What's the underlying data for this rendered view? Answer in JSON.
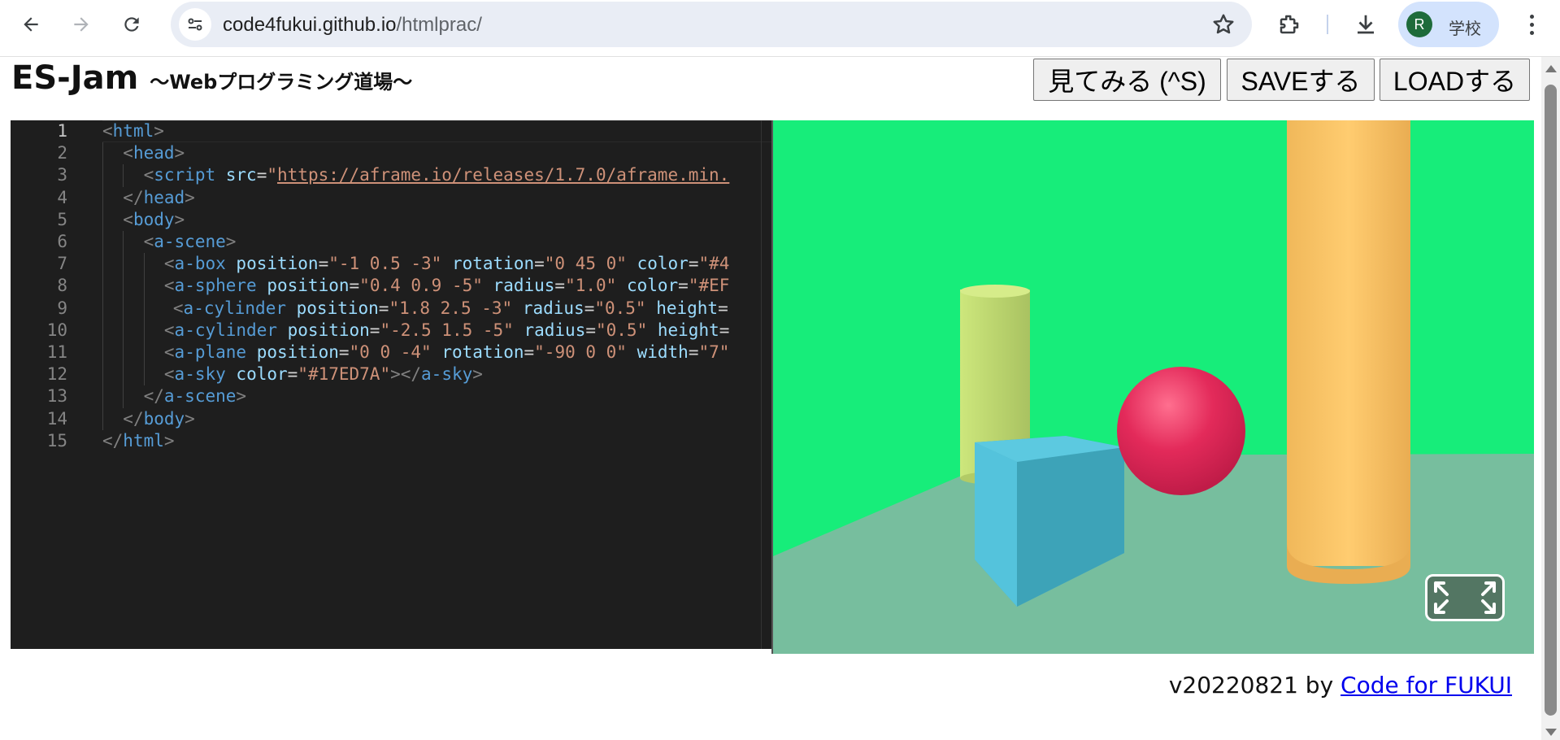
{
  "browser": {
    "url_host": "code4fukui.github.io",
    "url_path": "/htmlprac/",
    "profile_initial": "R",
    "profile_name": "学校",
    "icons": [
      "back-icon",
      "forward-icon",
      "reload-icon",
      "site-info-icon",
      "bookmark-star-icon",
      "extensions-icon",
      "download-icon",
      "kebab-menu-icon"
    ]
  },
  "header": {
    "title": "ES-Jam",
    "subtitle": "〜Webプログラミング道場〜",
    "buttons": {
      "view": "見てみる (^S)",
      "save": "SAVEする",
      "load": "LOADする"
    }
  },
  "editor": {
    "line_numbers": [
      "1",
      "2",
      "3",
      "4",
      "5",
      "6",
      "7",
      "8",
      "9",
      "10",
      "11",
      "12",
      "13",
      "14",
      "15"
    ],
    "active_line": 1,
    "lines": [
      [
        [
          "br",
          "<"
        ],
        [
          "tag",
          "html"
        ],
        [
          "br",
          ">"
        ]
      ],
      [
        [
          "br",
          "<"
        ],
        [
          "tag",
          "head"
        ],
        [
          "br",
          ">"
        ]
      ],
      [
        [
          "br",
          "<"
        ],
        [
          "tag",
          "script"
        ],
        [
          "txt",
          " "
        ],
        [
          "attr",
          "src"
        ],
        [
          "txt",
          "="
        ],
        [
          "str",
          "\""
        ],
        [
          "link",
          "https://aframe.io/releases/1.7.0/aframe.min."
        ]
      ],
      [
        [
          "br",
          "</"
        ],
        [
          "tag",
          "head"
        ],
        [
          "br",
          ">"
        ]
      ],
      [
        [
          "br",
          "<"
        ],
        [
          "tag",
          "body"
        ],
        [
          "br",
          ">"
        ]
      ],
      [
        [
          "br",
          "<"
        ],
        [
          "tag",
          "a-scene"
        ],
        [
          "br",
          ">"
        ]
      ],
      [
        [
          "br",
          "<"
        ],
        [
          "tag",
          "a-box"
        ],
        [
          "txt",
          " "
        ],
        [
          "attr",
          "position"
        ],
        [
          "txt",
          "="
        ],
        [
          "str",
          "\"-1 0.5 -3\""
        ],
        [
          "txt",
          " "
        ],
        [
          "attr",
          "rotation"
        ],
        [
          "txt",
          "="
        ],
        [
          "str",
          "\"0 45 0\""
        ],
        [
          "txt",
          " "
        ],
        [
          "attr",
          "color"
        ],
        [
          "txt",
          "="
        ],
        [
          "str",
          "\"#4"
        ]
      ],
      [
        [
          "br",
          "<"
        ],
        [
          "tag",
          "a-sphere"
        ],
        [
          "txt",
          " "
        ],
        [
          "attr",
          "position"
        ],
        [
          "txt",
          "="
        ],
        [
          "str",
          "\"0.4 0.9 -5\""
        ],
        [
          "txt",
          " "
        ],
        [
          "attr",
          "radius"
        ],
        [
          "txt",
          "="
        ],
        [
          "str",
          "\"1.0\""
        ],
        [
          "txt",
          " "
        ],
        [
          "attr",
          "color"
        ],
        [
          "txt",
          "="
        ],
        [
          "str",
          "\"#EF"
        ]
      ],
      [
        [
          "br",
          "<"
        ],
        [
          "tag",
          "a-cylinder"
        ],
        [
          "txt",
          " "
        ],
        [
          "attr",
          "position"
        ],
        [
          "txt",
          "="
        ],
        [
          "str",
          "\"1.8 2.5 -3\""
        ],
        [
          "txt",
          " "
        ],
        [
          "attr",
          "radius"
        ],
        [
          "txt",
          "="
        ],
        [
          "str",
          "\"0.5\""
        ],
        [
          "txt",
          " "
        ],
        [
          "attr",
          "height"
        ],
        [
          "txt",
          "="
        ]
      ],
      [
        [
          "br",
          "<"
        ],
        [
          "tag",
          "a-cylinder"
        ],
        [
          "txt",
          " "
        ],
        [
          "attr",
          "position"
        ],
        [
          "txt",
          "="
        ],
        [
          "str",
          "\"-2.5 1.5 -5\""
        ],
        [
          "txt",
          " "
        ],
        [
          "attr",
          "radius"
        ],
        [
          "txt",
          "="
        ],
        [
          "str",
          "\"0.5\""
        ],
        [
          "txt",
          " "
        ],
        [
          "attr",
          "height"
        ],
        [
          "txt",
          "="
        ]
      ],
      [
        [
          "br",
          "<"
        ],
        [
          "tag",
          "a-plane"
        ],
        [
          "txt",
          " "
        ],
        [
          "attr",
          "position"
        ],
        [
          "txt",
          "="
        ],
        [
          "str",
          "\"0 0 -4\""
        ],
        [
          "txt",
          " "
        ],
        [
          "attr",
          "rotation"
        ],
        [
          "txt",
          "="
        ],
        [
          "str",
          "\"-90 0 0\""
        ],
        [
          "txt",
          " "
        ],
        [
          "attr",
          "width"
        ],
        [
          "txt",
          "="
        ],
        [
          "str",
          "\"7\""
        ]
      ],
      [
        [
          "br",
          "<"
        ],
        [
          "tag",
          "a-sky"
        ],
        [
          "txt",
          " "
        ],
        [
          "attr",
          "color"
        ],
        [
          "txt",
          "="
        ],
        [
          "str",
          "\"#17ED7A\""
        ],
        [
          "br",
          "></"
        ],
        [
          "tag",
          "a-sky"
        ],
        [
          "br",
          ">"
        ]
      ],
      [
        [
          "br",
          "</"
        ],
        [
          "tag",
          "a-scene"
        ],
        [
          "br",
          ">"
        ]
      ],
      [
        [
          "br",
          "</"
        ],
        [
          "tag",
          "body"
        ],
        [
          "br",
          ">"
        ]
      ],
      [
        [
          "br",
          "</"
        ],
        [
          "tag",
          "html"
        ],
        [
          "br",
          ">"
        ]
      ]
    ]
  },
  "preview": {
    "sky_color": "#17ED7A",
    "plane_color": "#77BE9E",
    "box_color": "#4CC3D9",
    "sphere_color": "#EF2D5E",
    "cylinder_color": "#FFC65D",
    "cylinder2_color": "#C8E075",
    "vr_button_icon": "fullscreen-enter-icon"
  },
  "footer": {
    "version": "v20220821 by ",
    "link_text": "Code for FUKUI"
  }
}
